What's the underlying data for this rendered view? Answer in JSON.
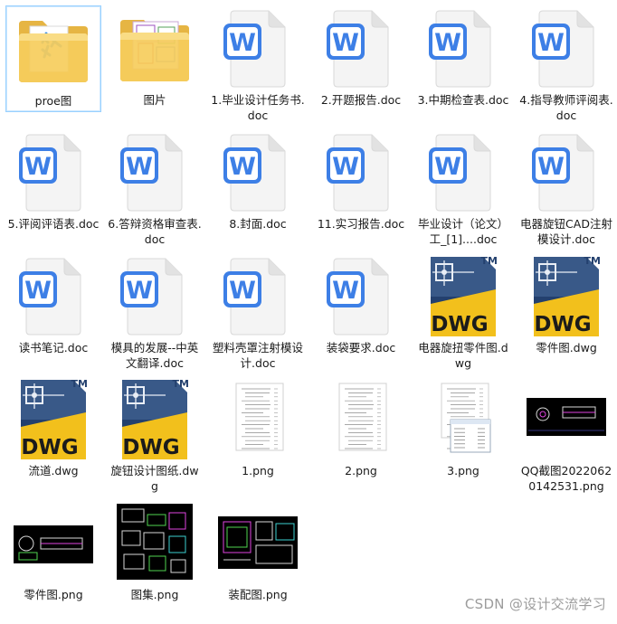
{
  "files": [
    {
      "label": "proe图",
      "icon": "folder-icon",
      "kind": "folder_proe",
      "selected": true
    },
    {
      "label": "图片",
      "icon": "folder-icon",
      "kind": "folder_img"
    },
    {
      "label": "1.毕业设计任务书.doc",
      "icon": "word-doc-icon",
      "kind": "doc"
    },
    {
      "label": "2.开题报告.doc",
      "icon": "word-doc-icon",
      "kind": "doc"
    },
    {
      "label": "3.中期检查表.doc",
      "icon": "word-doc-icon",
      "kind": "doc"
    },
    {
      "label": "4.指导教师评阅表.doc",
      "icon": "word-doc-icon",
      "kind": "doc"
    },
    {
      "label": "5.评阅评语表.doc",
      "icon": "word-doc-icon",
      "kind": "doc"
    },
    {
      "label": "6.答辩资格审查表.doc",
      "icon": "word-doc-icon",
      "kind": "doc"
    },
    {
      "label": "8.封面.doc",
      "icon": "word-doc-icon",
      "kind": "doc"
    },
    {
      "label": "11.实习报告.doc",
      "icon": "word-doc-icon",
      "kind": "doc"
    },
    {
      "label": "毕业设计（论文）工_[1]....doc",
      "icon": "word-doc-icon",
      "kind": "doc"
    },
    {
      "label": "电器旋钮CAD注射模设计.doc",
      "icon": "word-doc-icon",
      "kind": "doc"
    },
    {
      "label": "读书笔记.doc",
      "icon": "word-doc-icon",
      "kind": "doc"
    },
    {
      "label": "模具的发展--中英文翻译.doc",
      "icon": "word-doc-icon",
      "kind": "doc"
    },
    {
      "label": "塑料壳罩注射模设计.doc",
      "icon": "word-doc-icon",
      "kind": "doc"
    },
    {
      "label": "装袋要求.doc",
      "icon": "word-doc-icon",
      "kind": "doc"
    },
    {
      "label": "电器旋扭零件图.dwg",
      "icon": "dwg-file-icon",
      "kind": "dwg"
    },
    {
      "label": "零件图.dwg",
      "icon": "dwg-file-icon",
      "kind": "dwg"
    },
    {
      "label": "流道.dwg",
      "icon": "dwg-file-icon",
      "kind": "dwg"
    },
    {
      "label": "旋钮设计图纸.dwg",
      "icon": "dwg-file-icon",
      "kind": "dwg"
    },
    {
      "label": "1.png",
      "icon": "document-thumbnail-icon",
      "kind": "png_doc"
    },
    {
      "label": "2.png",
      "icon": "document-thumbnail-icon",
      "kind": "png_doc"
    },
    {
      "label": "3.png",
      "icon": "document-thumbnail-icon",
      "kind": "png_dialog"
    },
    {
      "label": "QQ截图20220620142531.png",
      "icon": "cad-thumbnail-icon",
      "kind": "png_cad"
    },
    {
      "label": "零件图.png",
      "icon": "cad-thumbnail-icon",
      "kind": "png_cad2"
    },
    {
      "label": "图集.png",
      "icon": "cad-thumbnail-icon",
      "kind": "png_cad3"
    },
    {
      "label": "装配图.png",
      "icon": "cad-thumbnail-icon",
      "kind": "png_cad4"
    }
  ],
  "icon_text": {
    "word_letter": "W",
    "dwg_text": "DWG",
    "tm_text": "TM"
  },
  "watermark": "CSDN @设计交流学习",
  "colors": {
    "selection_border": "#99d1ff",
    "word_blue": "#3d7fe6",
    "dwg_navy": "#23406e",
    "dwg_yellow": "#f2c01c",
    "folder_yellow": "#f6cd5c"
  }
}
